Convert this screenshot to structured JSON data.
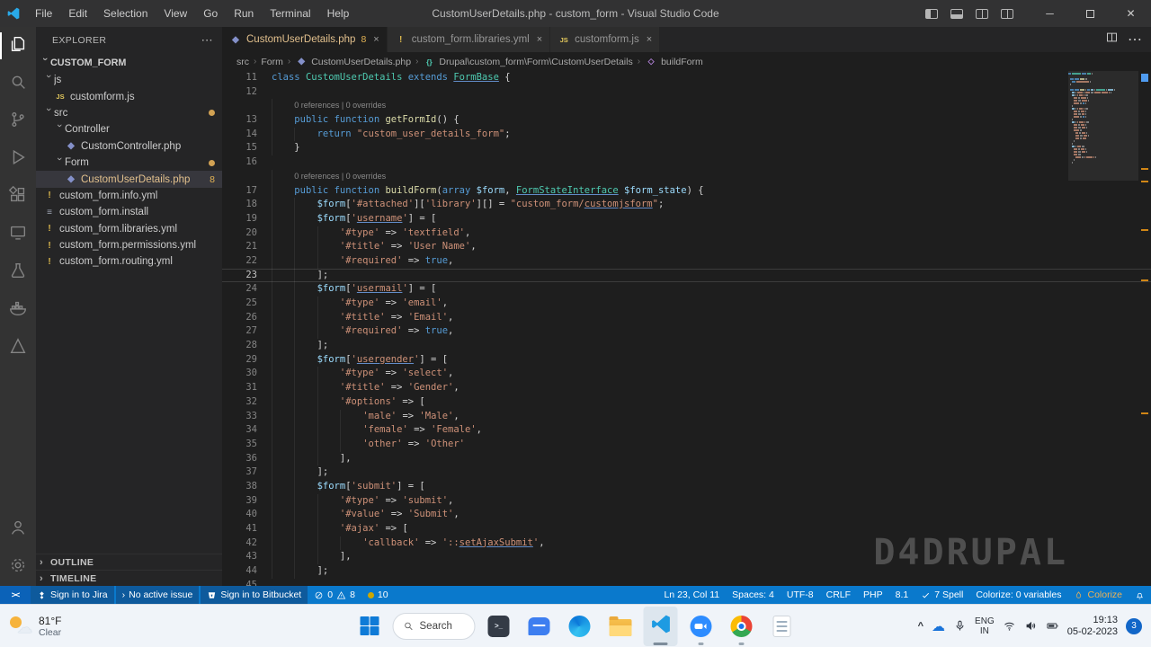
{
  "window": {
    "title": "CustomUserDetails.php - custom_form - Visual Studio Code",
    "menus": [
      "File",
      "Edit",
      "Selection",
      "View",
      "Go",
      "Run",
      "Terminal",
      "Help"
    ]
  },
  "activity_bar": {
    "top": [
      "explorer",
      "search",
      "source-control",
      "run-debug",
      "extensions",
      "remote-explorer",
      "testing",
      "docker",
      "azure"
    ],
    "active": "explorer",
    "bottom": [
      "accounts",
      "settings"
    ]
  },
  "explorer": {
    "header": "EXPLORER",
    "root": "CUSTOM_FORM",
    "tree": [
      {
        "label": "js",
        "kind": "folder",
        "indent": 0,
        "expanded": true
      },
      {
        "label": "customform.js",
        "kind": "file",
        "icon": "js",
        "indent": 1
      },
      {
        "label": "src",
        "kind": "folder",
        "indent": 0,
        "expanded": true,
        "dot": true
      },
      {
        "label": "Controller",
        "kind": "folder",
        "indent": 1,
        "expanded": true
      },
      {
        "label": "CustomController.php",
        "kind": "file",
        "icon": "php",
        "indent": 2
      },
      {
        "label": "Form",
        "kind": "folder",
        "indent": 1,
        "expanded": true,
        "dot": true
      },
      {
        "label": "CustomUserDetails.php",
        "kind": "file",
        "icon": "php",
        "indent": 2,
        "selected": true,
        "badge": "8"
      },
      {
        "label": "custom_form.info.yml",
        "kind": "file",
        "icon": "yml",
        "indent": 0
      },
      {
        "label": "custom_form.install",
        "kind": "file",
        "icon": "install",
        "indent": 0
      },
      {
        "label": "custom_form.libraries.yml",
        "kind": "file",
        "icon": "yml",
        "indent": 0
      },
      {
        "label": "custom_form.permissions.yml",
        "kind": "file",
        "icon": "yml",
        "indent": 0
      },
      {
        "label": "custom_form.routing.yml",
        "kind": "file",
        "icon": "yml",
        "indent": 0
      }
    ],
    "panels": [
      "OUTLINE",
      "TIMELINE"
    ]
  },
  "tabs": [
    {
      "label": "CustomUserDetails.php",
      "icon": "php",
      "badge": "8",
      "active": true
    },
    {
      "label": "custom_form.libraries.yml",
      "icon": "yml"
    },
    {
      "label": "customform.js",
      "icon": "js"
    }
  ],
  "breadcrumb": [
    {
      "label": "src"
    },
    {
      "label": "Form"
    },
    {
      "label": "CustomUserDetails.php",
      "icon": "php"
    },
    {
      "label": "Drupal\\custom_form\\Form\\CustomUserDetails",
      "icon": "namespace"
    },
    {
      "label": "buildForm",
      "icon": "method"
    }
  ],
  "editor": {
    "annotation": "0 references | 0 overrides",
    "current_line": 23,
    "watermark": "D4DRUPAL",
    "lines": [
      {
        "n": 11,
        "ind": 0,
        "t": [
          [
            "k",
            "class "
          ],
          [
            "ty",
            "CustomUserDetails "
          ],
          [
            "k",
            "extends "
          ],
          [
            "tyu",
            "FormBase"
          ],
          [
            "p",
            " {"
          ]
        ]
      },
      {
        "n": 12,
        "ind": 0,
        "t": []
      },
      {
        "ann": true,
        "ind": 1
      },
      {
        "n": 13,
        "ind": 1,
        "t": [
          [
            "k",
            "public "
          ],
          [
            "k",
            "function "
          ],
          [
            "fn",
            "getFormId"
          ],
          [
            "p",
            "() {"
          ]
        ]
      },
      {
        "n": 14,
        "ind": 2,
        "t": [
          [
            "k",
            "return "
          ],
          [
            "s",
            "\"custom_user_details_form\""
          ],
          [
            "p",
            ";"
          ]
        ]
      },
      {
        "n": 15,
        "ind": 1,
        "t": [
          [
            "p",
            "}"
          ]
        ]
      },
      {
        "n": 16,
        "ind": 0,
        "t": []
      },
      {
        "ann": true,
        "ind": 1
      },
      {
        "n": 17,
        "ind": 1,
        "t": [
          [
            "k",
            "public "
          ],
          [
            "k",
            "function "
          ],
          [
            "fn",
            "buildForm"
          ],
          [
            "p",
            "("
          ],
          [
            "k",
            "array "
          ],
          [
            "v",
            "$form"
          ],
          [
            "p",
            ", "
          ],
          [
            "tyu",
            "FormStateInterface"
          ],
          [
            "p",
            " "
          ],
          [
            "v",
            "$form_state"
          ],
          [
            "p",
            ") {"
          ]
        ]
      },
      {
        "n": 18,
        "ind": 2,
        "t": [
          [
            "v",
            "$form"
          ],
          [
            "p",
            "["
          ],
          [
            "s",
            "'#attached'"
          ],
          [
            "p",
            "]["
          ],
          [
            "s",
            "'library'"
          ],
          [
            "p",
            "][] = "
          ],
          [
            "s",
            "\"custom_form/"
          ],
          [
            "su",
            "customjsform"
          ],
          [
            "s",
            "\""
          ],
          [
            "p",
            ";"
          ]
        ]
      },
      {
        "n": 19,
        "ind": 2,
        "t": [
          [
            "v",
            "$form"
          ],
          [
            "p",
            "["
          ],
          [
            "s",
            "'"
          ],
          [
            "su",
            "username"
          ],
          [
            "s",
            "'"
          ],
          [
            "p",
            "] = ["
          ]
        ]
      },
      {
        "n": 20,
        "ind": 3,
        "t": [
          [
            "s",
            "'#type'"
          ],
          [
            "p",
            " => "
          ],
          [
            "s",
            "'textfield'"
          ],
          [
            "p",
            ","
          ]
        ]
      },
      {
        "n": 21,
        "ind": 3,
        "t": [
          [
            "s",
            "'#title'"
          ],
          [
            "p",
            " => "
          ],
          [
            "s",
            "'User Name'"
          ],
          [
            "p",
            ","
          ]
        ]
      },
      {
        "n": 22,
        "ind": 3,
        "t": [
          [
            "s",
            "'#required'"
          ],
          [
            "p",
            " => "
          ],
          [
            "k",
            "true"
          ],
          [
            "p",
            ","
          ]
        ]
      },
      {
        "n": 23,
        "ind": 2,
        "t": [
          [
            "p",
            "];"
          ]
        ]
      },
      {
        "n": 24,
        "ind": 2,
        "t": [
          [
            "v",
            "$form"
          ],
          [
            "p",
            "["
          ],
          [
            "s",
            "'"
          ],
          [
            "su",
            "usermail"
          ],
          [
            "s",
            "'"
          ],
          [
            "p",
            "] = ["
          ]
        ]
      },
      {
        "n": 25,
        "ind": 3,
        "t": [
          [
            "s",
            "'#type'"
          ],
          [
            "p",
            " => "
          ],
          [
            "s",
            "'email'"
          ],
          [
            "p",
            ","
          ]
        ]
      },
      {
        "n": 26,
        "ind": 3,
        "t": [
          [
            "s",
            "'#title'"
          ],
          [
            "p",
            " => "
          ],
          [
            "s",
            "'Email'"
          ],
          [
            "p",
            ","
          ]
        ]
      },
      {
        "n": 27,
        "ind": 3,
        "t": [
          [
            "s",
            "'#required'"
          ],
          [
            "p",
            " => "
          ],
          [
            "k",
            "true"
          ],
          [
            "p",
            ","
          ]
        ]
      },
      {
        "n": 28,
        "ind": 2,
        "t": [
          [
            "p",
            "];"
          ]
        ]
      },
      {
        "n": 29,
        "ind": 2,
        "t": [
          [
            "v",
            "$form"
          ],
          [
            "p",
            "["
          ],
          [
            "s",
            "'"
          ],
          [
            "su",
            "usergender"
          ],
          [
            "s",
            "'"
          ],
          [
            "p",
            "] = ["
          ]
        ]
      },
      {
        "n": 30,
        "ind": 3,
        "t": [
          [
            "s",
            "'#type'"
          ],
          [
            "p",
            " => "
          ],
          [
            "s",
            "'select'"
          ],
          [
            "p",
            ","
          ]
        ]
      },
      {
        "n": 31,
        "ind": 3,
        "t": [
          [
            "s",
            "'#title'"
          ],
          [
            "p",
            " => "
          ],
          [
            "s",
            "'Gender'"
          ],
          [
            "p",
            ","
          ]
        ]
      },
      {
        "n": 32,
        "ind": 3,
        "t": [
          [
            "s",
            "'#options'"
          ],
          [
            "p",
            " => ["
          ]
        ]
      },
      {
        "n": 33,
        "ind": 4,
        "t": [
          [
            "s",
            "'male'"
          ],
          [
            "p",
            " => "
          ],
          [
            "s",
            "'Male'"
          ],
          [
            "p",
            ","
          ]
        ]
      },
      {
        "n": 34,
        "ind": 4,
        "t": [
          [
            "s",
            "'female'"
          ],
          [
            "p",
            " => "
          ],
          [
            "s",
            "'Female'"
          ],
          [
            "p",
            ","
          ]
        ]
      },
      {
        "n": 35,
        "ind": 4,
        "t": [
          [
            "s",
            "'other'"
          ],
          [
            "p",
            " => "
          ],
          [
            "s",
            "'Other'"
          ]
        ]
      },
      {
        "n": 36,
        "ind": 3,
        "t": [
          [
            "p",
            "],"
          ]
        ]
      },
      {
        "n": 37,
        "ind": 2,
        "t": [
          [
            "p",
            "];"
          ]
        ]
      },
      {
        "n": 38,
        "ind": 2,
        "t": [
          [
            "v",
            "$form"
          ],
          [
            "p",
            "["
          ],
          [
            "s",
            "'submit'"
          ],
          [
            "p",
            "] = ["
          ]
        ]
      },
      {
        "n": 39,
        "ind": 3,
        "t": [
          [
            "s",
            "'#type'"
          ],
          [
            "p",
            " => "
          ],
          [
            "s",
            "'submit'"
          ],
          [
            "p",
            ","
          ]
        ]
      },
      {
        "n": 40,
        "ind": 3,
        "t": [
          [
            "s",
            "'#value'"
          ],
          [
            "p",
            " => "
          ],
          [
            "s",
            "'Submit'"
          ],
          [
            "p",
            ","
          ]
        ]
      },
      {
        "n": 41,
        "ind": 3,
        "t": [
          [
            "s",
            "'#ajax'"
          ],
          [
            "p",
            " => ["
          ]
        ]
      },
      {
        "n": 42,
        "ind": 4,
        "t": [
          [
            "s",
            "'callback'"
          ],
          [
            "p",
            " => "
          ],
          [
            "s",
            "'::"
          ],
          [
            "su",
            "setAjaxSubmit"
          ],
          [
            "s",
            "'"
          ],
          [
            "p",
            ","
          ]
        ]
      },
      {
        "n": 43,
        "ind": 3,
        "t": [
          [
            "p",
            "],"
          ]
        ]
      },
      {
        "n": 44,
        "ind": 2,
        "t": [
          [
            "p",
            "];"
          ]
        ]
      },
      {
        "n": 45,
        "ind": 0,
        "t": []
      }
    ]
  },
  "status_bar": {
    "jira": "Sign in to Jira",
    "issue": "No active issue",
    "bitbucket": "Sign in to Bitbucket",
    "errors": "0",
    "warnings": "8",
    "dot_count": "10",
    "right": [
      {
        "name": "cursor-position",
        "label": "Ln 23, Col 11"
      },
      {
        "name": "indentation",
        "label": "Spaces: 4"
      },
      {
        "name": "encoding",
        "label": "UTF-8"
      },
      {
        "name": "eol",
        "label": "CRLF"
      },
      {
        "name": "language-mode",
        "label": "PHP"
      },
      {
        "name": "php-version",
        "label": "8.1"
      },
      {
        "name": "spell-checker",
        "label": "7 Spell",
        "icon": "check"
      },
      {
        "name": "colorize-variables",
        "label": "Colorize: 0 variables"
      }
    ],
    "colorize": "Colorize"
  },
  "taskbar": {
    "weather": {
      "temp": "81°F",
      "condition": "Clear"
    },
    "search": "Search",
    "apps": [
      "start",
      "search",
      "terminal",
      "chat",
      "edge",
      "file-explorer",
      "vscode",
      "zoom",
      "chrome",
      "notes"
    ],
    "active_app": "vscode",
    "running_apps": [
      "zoom",
      "chrome"
    ],
    "tray": {
      "language": "ENG",
      "region": "IN",
      "time": "19:13",
      "date": "05-02-2023",
      "notifications": "3"
    }
  }
}
